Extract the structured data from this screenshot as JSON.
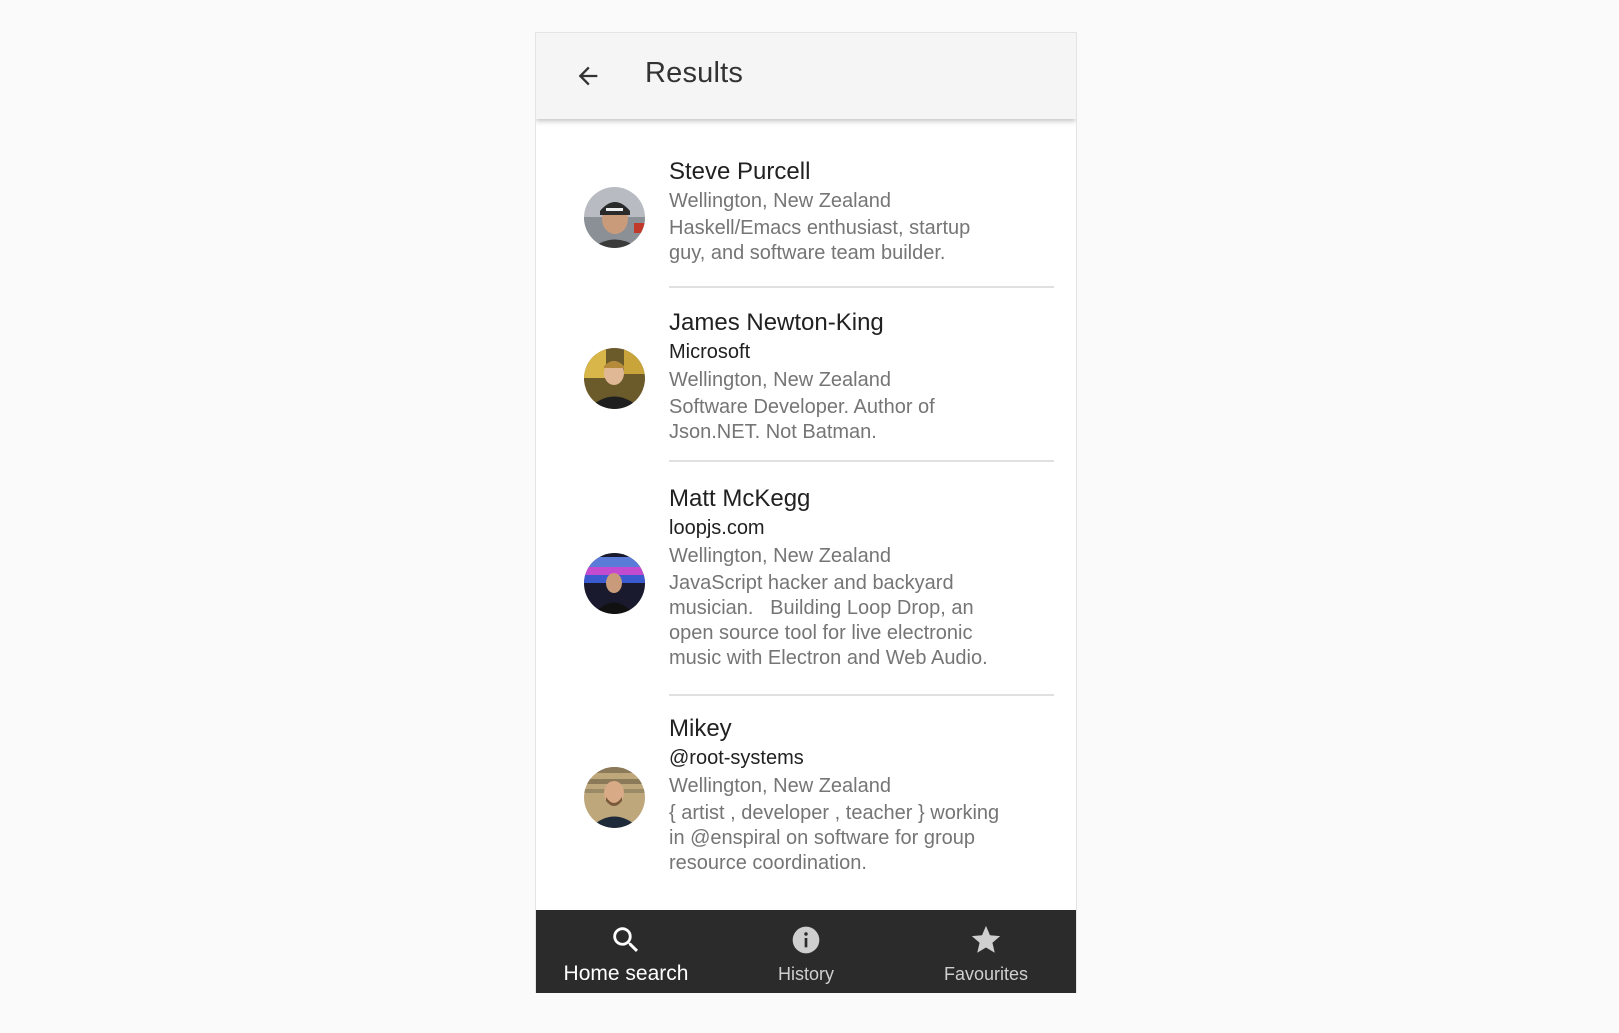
{
  "app_bar": {
    "title": "Results",
    "back_icon": "arrow-left-icon"
  },
  "results": [
    {
      "name": "Steve Purcell",
      "location": "Wellington, New Zealand",
      "bio_lines": [
        "Haskell/Emacs enthusiast, startup",
        "guy, and software team builder."
      ]
    },
    {
      "name": "James Newton-King",
      "company": "Microsoft",
      "location": "Wellington, New Zealand",
      "bio_lines": [
        "Software Developer. Author of",
        "Json.NET. Not Batman."
      ]
    },
    {
      "name": "Matt McKegg",
      "company": "loopjs.com",
      "location": "Wellington, New Zealand",
      "bio_lines": [
        "JavaScript hacker and backyard",
        "musician.   Building Loop Drop, an",
        "open source tool for live electronic",
        "music with Electron and Web Audio."
      ]
    },
    {
      "name": "Mikey",
      "company": "@root-systems",
      "location": "Wellington, New Zealand",
      "bio_lines": [
        "{ artist , developer , teacher } working",
        "in @enspiral on software for group",
        "resource coordination."
      ]
    }
  ],
  "bottom_nav": {
    "items": [
      {
        "label": "Home search",
        "icon": "search-icon",
        "active": true
      },
      {
        "label": "History",
        "icon": "info-icon",
        "active": false
      },
      {
        "label": "Favourites",
        "icon": "star-icon",
        "active": false
      }
    ]
  },
  "colors": {
    "app_bar_bg": "#f5f5f5",
    "bottom_nav_bg": "#2b2b2b",
    "primary_text": "#212121",
    "secondary_text": "#757575",
    "divider": "#e0e0e0"
  }
}
